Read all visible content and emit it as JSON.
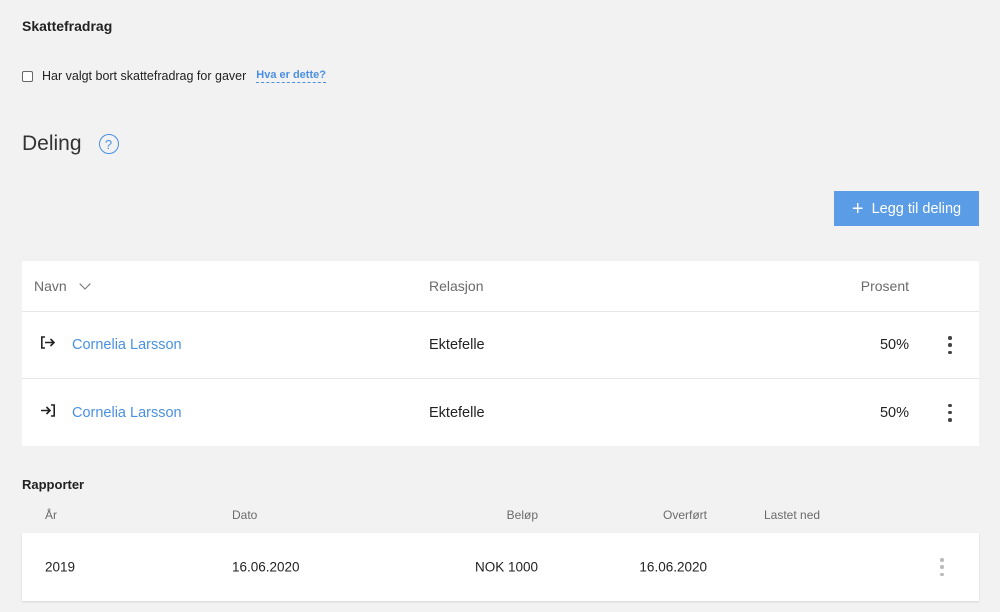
{
  "skattefradrag": {
    "title": "Skattefradrag",
    "checkbox_label": "Har valgt bort skattefradrag for gaver",
    "help_link": "Hva er dette?"
  },
  "deling": {
    "title": "Deling",
    "help_icon": "?",
    "add_button": "Legg til deling",
    "add_icon": "+",
    "columns": {
      "name": "Navn",
      "relation": "Relasjon",
      "percent": "Prosent"
    },
    "rows": [
      {
        "direction_icon": "↦",
        "direction": "outgoing",
        "name": "Cornelia Larsson",
        "relation": "Ektefelle",
        "percent": "50%"
      },
      {
        "direction_icon": "→",
        "direction": "incoming",
        "name": "Cornelia Larsson",
        "relation": "Ektefelle",
        "percent": "50%"
      }
    ]
  },
  "reports": {
    "title": "Rapporter",
    "columns": {
      "year": "År",
      "date": "Dato",
      "amount": "Beløp",
      "transferred": "Overført",
      "downloaded": "Lastet ned"
    },
    "rows": [
      {
        "year": "2019",
        "date": "16.06.2020",
        "amount": "NOK 1000",
        "transferred": "16.06.2020",
        "downloaded": ""
      }
    ]
  },
  "icons": {
    "help": "question-circle-icon",
    "add": "plus-icon",
    "sort": "chevron-down-icon",
    "outgoing": "arrow-out-icon",
    "incoming": "arrow-in-icon",
    "menu": "kebab-menu-icon"
  },
  "colors": {
    "accent": "#4a90e2",
    "button": "#5a9de6",
    "background": "#f2f2f2"
  }
}
